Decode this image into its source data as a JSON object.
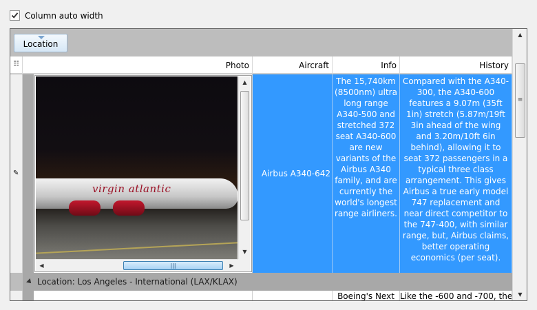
{
  "options": {
    "column_auto_width_label": "Column auto width",
    "column_auto_width_checked": true
  },
  "group_panel": {
    "group_button_label": "Location"
  },
  "columns": {
    "photo": "Photo",
    "aircraft": "Aircraft",
    "info": "Info",
    "history": "History"
  },
  "rows": [
    {
      "aircraft": "Airbus A340-642",
      "info": "The 15,740km (8500nm) ultra long range A340-500 and stretched 372 seat A340-600 are new variants of the Airbus A340 family, and are currently the world's longest range airliners.",
      "history": "Compared with the A340-300, the A340-600 features a 9.07m (35ft 1in) stretch (5.87m/19ft 3in ahead of the wing and 3.20m/10ft 6in behind), allowing it to seat 372 passengers in a typical three class arrangement. This gives Airbus a true early model 747 replacement and near direct competitor to the 747-400, with similar range, but, Airbus claims, better operating economics (per seat).",
      "photo_caption": "virgin atlantic"
    }
  ],
  "group_row": {
    "label": "Location: Los Angeles - International (LAX/KLAX)"
  },
  "next_row": {
    "info": "Boeing's Next",
    "history": "Like the -600 and -700, the"
  },
  "icons": {
    "checkbox": "check-icon",
    "row_indicator": "pencil-icon",
    "group_expand": "triangle-icon",
    "sort": "sort-arrow-icon"
  },
  "colors": {
    "selection": "#3399ff",
    "group_row": "#a8a8a8",
    "group_panel": "#bdbdbd"
  }
}
